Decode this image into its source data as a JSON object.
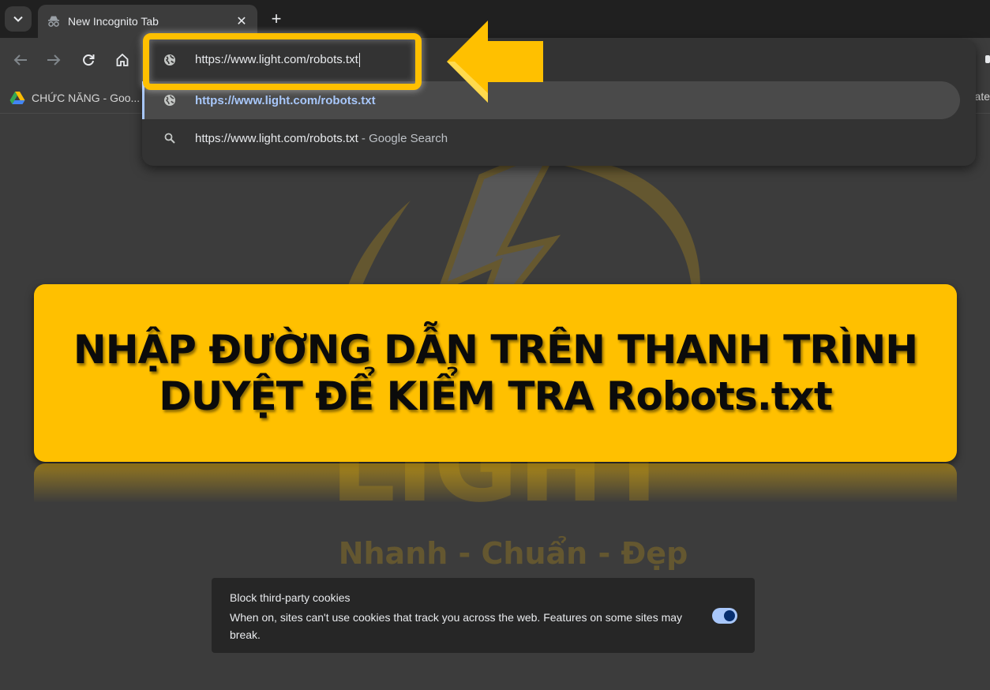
{
  "browser": {
    "tab": {
      "title": "New Incognito Tab",
      "icon": "incognito-icon",
      "close_icon": "close-icon"
    },
    "tab_search_icon": "chevron-down-icon",
    "new_tab_label": "+",
    "toolbar": {
      "back_icon": "arrow-left-icon",
      "forward_icon": "arrow-right-icon",
      "reload_icon": "reload-icon",
      "home_icon": "home-icon"
    },
    "bookmarks": {
      "items": [
        {
          "label": "CHỨC NĂNG - Goo...",
          "icon": "google-drive-icon"
        }
      ],
      "overflow_partial": "late"
    },
    "omnibox": {
      "value": "https://www.light.com/robots.txt",
      "icon": "globe-icon",
      "suggestions": [
        {
          "icon": "globe-icon",
          "text": "https://www.light.com/robots.txt",
          "suffix": "",
          "selected": true
        },
        {
          "icon": "search-icon",
          "text": "https://www.light.com/robots.txt",
          "suffix": " - Google Search",
          "selected": false
        }
      ]
    }
  },
  "annotation": {
    "highlight_color": "#ffc000",
    "arrow_color": "#ffc000",
    "banner": {
      "line1": "NHẬP ĐƯỜNG DẪN TRÊN THANH TRÌNH",
      "line2": "DUYỆT ĐỂ KIỂM TRA Robots.txt",
      "background": "#ffc000"
    }
  },
  "watermark": {
    "brand": "LIGHT",
    "slogan": "Nhanh - Chuẩn - Đẹp"
  },
  "cookie_card": {
    "title": "Block third-party cookies",
    "description": "When on, sites can't use cookies that track you across the web. Features on some sites may break.",
    "toggle_on": true,
    "accent": "#a8c7fa"
  }
}
